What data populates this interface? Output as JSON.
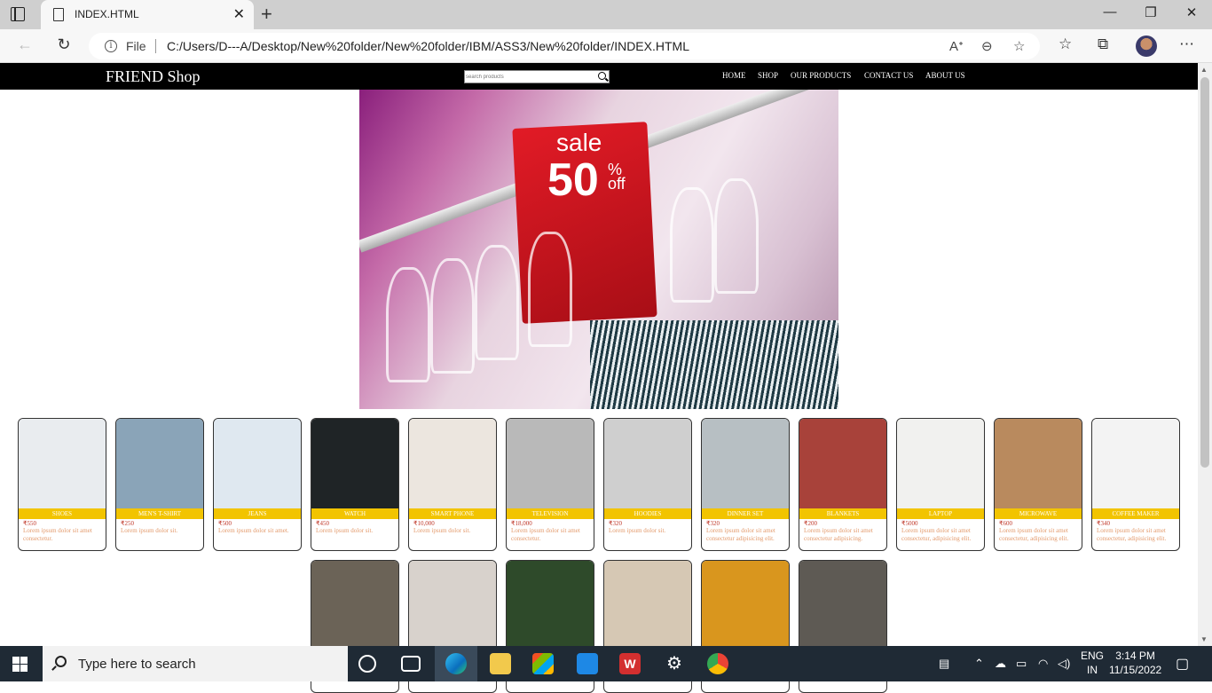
{
  "browser": {
    "tab_title": "INDEX.HTML",
    "file_label": "File",
    "url": "C:/Users/D---A/Desktop/New%20folder/New%20folder/IBM/ASS3/New%20folder/INDEX.HTML"
  },
  "site": {
    "brand": "FRIEND Shop",
    "search_placeholder": "search products",
    "nav": [
      "HOME",
      "SHOP",
      "OUR PRODUCTS",
      "CONTACT US",
      "ABOUT US"
    ],
    "hero": {
      "sign_sale": "sale",
      "sign_number": "50",
      "sign_pct": "%",
      "sign_off": "off"
    }
  },
  "products": [
    {
      "category": "SHOES",
      "price": "₹550",
      "desc": "Lorem ipsum dolor sit amet consectetur.",
      "bg": "#e9ecef"
    },
    {
      "category": "MEN's T-SHIRT",
      "price": "₹250",
      "desc": "Lorem ipsum dolor sit.",
      "bg": "#8aa4b8"
    },
    {
      "category": "JEANS",
      "price": "₹500",
      "desc": "Lorem ipsum dolor sit amet.",
      "bg": "#dfe8f0"
    },
    {
      "category": "WATCH",
      "price": "₹450",
      "desc": "Lorem ipsum dolor sit.",
      "bg": "#1f2426"
    },
    {
      "category": "SMART PHONE",
      "price": "₹10,000",
      "desc": "Lorem ipsum dolor sit.",
      "bg": "#ece6df"
    },
    {
      "category": "TELEVISION",
      "price": "₹18,000",
      "desc": "Lorem ipsum dolor sit amet consectetur.",
      "bg": "#b9b9b9"
    },
    {
      "category": "HOODIES",
      "price": "₹320",
      "desc": "Lorem ipsum dolor sit.",
      "bg": "#cfcfcf"
    },
    {
      "category": "DINNER SET",
      "price": "₹320",
      "desc": "Lorem ipsum dolor sit amet consectetur adipisicing elit.",
      "bg": "#b7bfc3"
    },
    {
      "category": "BLANKETS",
      "price": "₹200",
      "desc": "Lorem ipsum dolor sit amet consectetur adipisicing.",
      "bg": "#a8423a"
    },
    {
      "category": "LAPTOP",
      "price": "₹5000",
      "desc": "Lorem ipsum dolor sit amet consectetur, adipisicing elit.",
      "bg": "#f1f1ef"
    },
    {
      "category": "MICROWAVE",
      "price": "₹600",
      "desc": "Lorem ipsum dolor sit amet consectetur, adipisicing elit.",
      "bg": "#b98a5e"
    },
    {
      "category": "COFFEE MAKER",
      "price": "₹340",
      "desc": "Lorem ipsum dolor sit amet consectetur, adipisicing elit.",
      "bg": "#f3f3f3"
    }
  ],
  "products_row2": [
    {
      "bg": "#6b6357"
    },
    {
      "bg": "#d8d2cc"
    },
    {
      "bg": "#2e4a2a"
    },
    {
      "bg": "#d6c8b4"
    },
    {
      "bg": "#d9961e"
    },
    {
      "bg": "#5e5a54"
    }
  ],
  "taskbar": {
    "search_label": "Type here to search",
    "lang_top": "ENG",
    "lang_bottom": "IN",
    "time": "3:14 PM",
    "date": "11/15/2022"
  }
}
